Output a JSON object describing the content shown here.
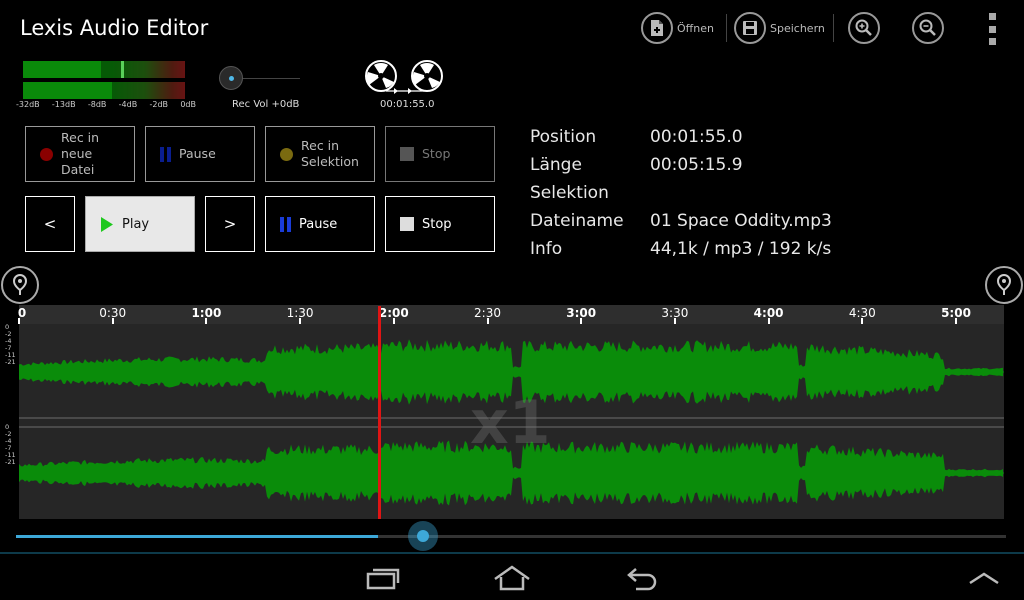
{
  "app": {
    "title": "Lexis Audio Editor"
  },
  "actionbar": {
    "open_label": "Öffnen",
    "save_label": "Speichern"
  },
  "meters": {
    "scale": [
      "-32dB",
      "-13dB",
      "-8dB",
      "-4dB",
      "-2dB",
      "0dB"
    ],
    "left_level": 0.48,
    "right_level": 0.55,
    "rec_vol_label": "Rec Vol +0dB",
    "reel_time": "00:01:55.0"
  },
  "buttons": {
    "rec_new": "Rec in neue Datei",
    "pause_rec": "Pause",
    "rec_selection": "Rec in Selektion",
    "stop_rec": "Stop",
    "prev": "<",
    "play": "Play",
    "next": ">",
    "pause": "Pause",
    "stop": "Stop"
  },
  "info": {
    "rows": [
      {
        "label": "Position",
        "value": "00:01:55.0"
      },
      {
        "label": "Länge",
        "value": "00:05:15.9"
      },
      {
        "label": "Selektion",
        "value": ""
      },
      {
        "label": "Dateiname",
        "value": "01 Space Oddity.mp3"
      },
      {
        "label": "Info",
        "value": "44,1k / mp3 / 192 k/s"
      }
    ]
  },
  "timeline": {
    "labels": [
      "0",
      "0:30",
      "1:00",
      "1:30",
      "2:00",
      "2:30",
      "3:00",
      "3:30",
      "4:00",
      "4:30",
      "5:00"
    ],
    "bold": [
      true,
      false,
      true,
      false,
      true,
      false,
      true,
      false,
      true,
      false,
      true
    ]
  },
  "waveform": {
    "db_labels": [
      "0",
      "-2",
      "-4",
      "-7",
      "-11",
      "-21"
    ],
    "zoom": "x1"
  },
  "playback": {
    "position_s": 115.0,
    "length_s": 315.9
  },
  "colors": {
    "wave": "#0a8c0a",
    "playhead": "#e01414",
    "accent": "#3da8d8"
  }
}
